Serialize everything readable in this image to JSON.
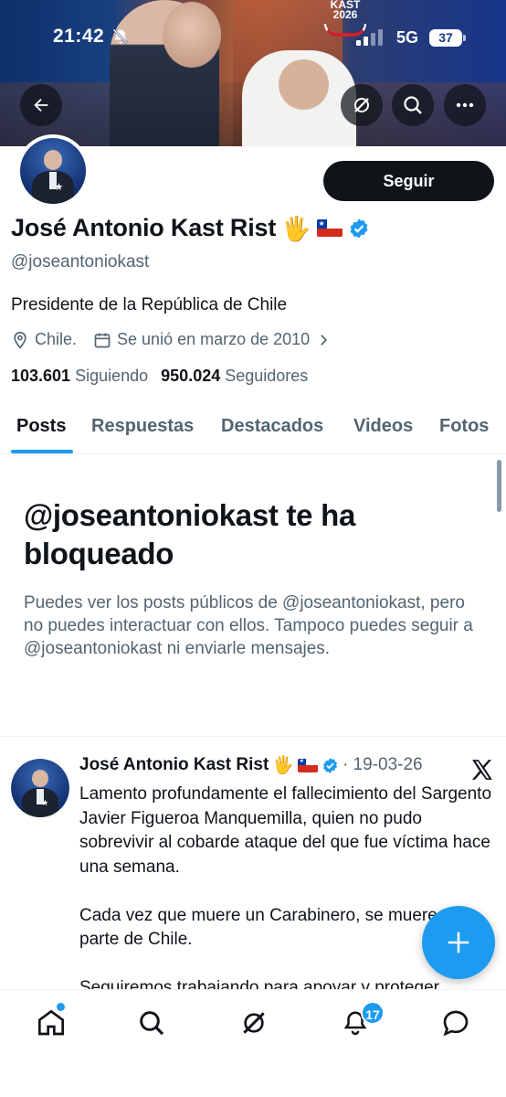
{
  "status_bar": {
    "time": "21:42",
    "network": "5G",
    "battery": "37"
  },
  "banner": {
    "logo_text_line1": "KAST",
    "logo_text_line2": "2026"
  },
  "header_actions": {
    "back_icon": "arrow-left-icon",
    "grok_icon": "grok-icon",
    "search_icon": "search-icon",
    "more_icon": "more-horizontal-icon"
  },
  "profile": {
    "follow_label": "Seguir",
    "name": "José Antonio Kast Rist",
    "name_emoji": "🖐",
    "handle": "@joseantoniokast",
    "bio": "Presidente de la República de Chile",
    "location": "Chile.",
    "joined": "Se unió en marzo de 2010",
    "following_count": "103.601",
    "following_label": "Siguiendo",
    "followers_count": "950.024",
    "followers_label": "Seguidores"
  },
  "tabs": [
    {
      "label": "Posts",
      "active": true
    },
    {
      "label": "Respuestas",
      "active": false
    },
    {
      "label": "Destacados",
      "active": false
    },
    {
      "label": "Videos",
      "active": false
    },
    {
      "label": "Fotos",
      "active": false
    }
  ],
  "blocked": {
    "title": "@joseantoniokast te ha bloqueado",
    "message": "Puedes ver los posts públicos de @joseantoniokast, pero no puedes interactuar con ellos. Tampoco puedes seguir a @joseantoniokast ni enviarle mensajes."
  },
  "post": {
    "author": "José Antonio Kast Rist",
    "emoji": "🖐",
    "date": "· 19-03-26",
    "paragraph1": "Lamento profundamente el fallecimiento del Sargento Javier Figueroa Manquemilla, quien no pudo sobrevivir al cobarde ataque del que fue víctima hace una semana.",
    "paragraph2": "Cada vez que muere un Carabinero, se muere una parte de Chile.",
    "paragraph3": "Seguiremos trabajando para apoyar y proteger"
  },
  "bottom_nav": {
    "notifications_badge": "17"
  },
  "colors": {
    "accent": "#1d9bf0",
    "text_primary": "#0f1419",
    "text_secondary": "#536471"
  }
}
